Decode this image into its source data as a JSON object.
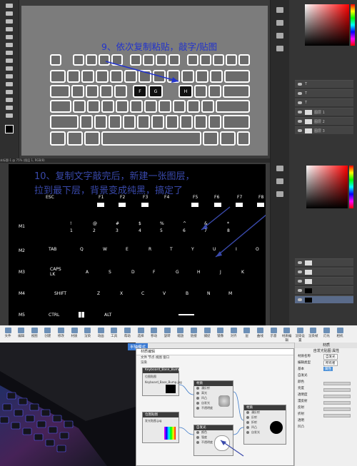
{
  "panel1": {
    "caption": "9、依次复制粘贴，敲字/贴图",
    "highlight_keys": [
      "F",
      "G",
      "H"
    ],
    "layers": [
      "T",
      "T",
      "T",
      "图层 1",
      "图层 2",
      "图层 3"
    ]
  },
  "panel2": {
    "caption_line1": "10、复制文字敲完后，新建一张图层，",
    "caption_line2": "拉到最下层，背景变成纯黑，搞定了",
    "tab_title": "未标题-1 @ 75% (图层 1, RGB/8)",
    "keys": {
      "esc": "ESC",
      "f1": "F1",
      "f2": "F2",
      "f3": "F3",
      "f4": "F4",
      "f5": "F5",
      "f6": "F6",
      "f7": "F7",
      "f8": "F8",
      "m1": "M1",
      "m2": "M2",
      "m3": "M3",
      "m4": "M4",
      "m5": "M5",
      "tab": "TAB",
      "caps": "CAPS\nLK",
      "shift": "SHIFT",
      "ctrl": "CTRL",
      "alt": "ALT",
      "n1": "1",
      "n2": "2",
      "n3": "3",
      "n4": "4",
      "n5": "5",
      "n6": "6",
      "n7": "7",
      "n8": "8",
      "s1": "!",
      "s2": "@",
      "s3": "#",
      "s4": "$",
      "s5": "%",
      "s6": "^",
      "s7": "&",
      "s8": "*",
      "q": "Q",
      "w": "W",
      "e": "E",
      "r": "R",
      "t": "T",
      "y": "Y",
      "u": "U",
      "i": "I",
      "o": "O",
      "a": "A",
      "s": "S",
      "d": "D",
      "f": "F",
      "g": "G",
      "h": "H",
      "j": "J",
      "k": "K",
      "z": "Z",
      "x": "X",
      "c": "C",
      "v": "V",
      "b": "B",
      "n": "N",
      "m": "M"
    }
  },
  "panel3": {
    "mode_tag": "半轴模式",
    "window_title": "材质编辑",
    "menu": "文件  节点  视图  窗口",
    "tree_label": "渲染",
    "node_texture_title": "Keyboard_Base_Bump",
    "node_texture2_label": "位图贴图",
    "node_texture2_file": "Keyboard_Base_Bump.jpg",
    "node_texture3_label": "位图贴图",
    "node_texture3_file": "发光贴图.jpg",
    "node_mat1_title": "材质",
    "node_mat1_ports": [
      "漫反射",
      "高光",
      "凹凸",
      "自发光",
      "不透明度"
    ],
    "node_mat2_title": "自发光",
    "node_mat2_ports": [
      "颜色",
      "强度",
      "不透明度"
    ],
    "node_out_title": "材质",
    "node_out_ports": [
      "漫反射",
      "反射",
      "折射",
      "凹凸",
      "自发光"
    ],
    "node_preview_title": "渲染",
    "right_header": "材质",
    "right_title": "自发光贴图 属性",
    "right_props": [
      "材质名称",
      "编辑类型",
      "基本",
      "自发光",
      "颜色",
      "亮度",
      "透明度",
      "漫反射",
      "反射",
      "折射",
      "透明",
      "凹凸"
    ],
    "right_values": [
      "自发光",
      "所有者",
      "属性",
      "",
      "",
      "",
      "",
      "",
      "",
      "",
      "",
      ""
    ],
    "toolbar": [
      "文件",
      "编辑",
      "视图",
      "创建",
      "修改",
      "材质",
      "渲染",
      "动画",
      "工具",
      "帮助",
      "选择",
      "移动",
      "旋转",
      "缩放",
      "链接",
      "捕捉",
      "镜像",
      "对齐",
      "层",
      "曲线",
      "示意",
      "材质编辑",
      "渲染设置",
      "渲染帧",
      "灯光",
      "相机"
    ]
  }
}
